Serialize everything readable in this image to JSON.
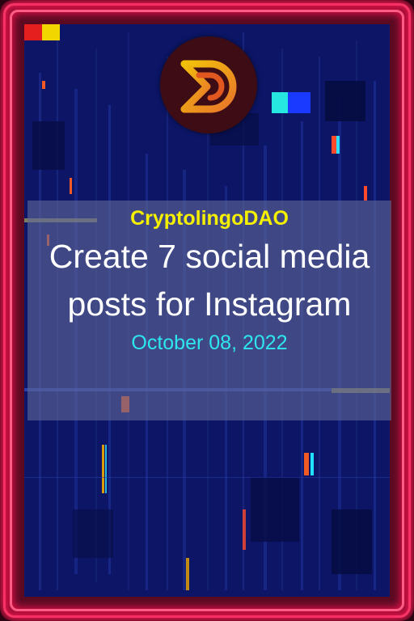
{
  "card": {
    "organization": "CryptolingoDAO",
    "title": "Create 7 social media posts for Instagram",
    "date": "October 08, 2022"
  },
  "logo": {
    "icon": "cryptolingo-d-logo-icon"
  },
  "colors": {
    "frame_glow": "#ff2a60",
    "background": "#0b1463",
    "organization_text": "#f5f000",
    "title_text": "#ffffff",
    "date_text": "#2ee6f0",
    "logo_circle": "#3d0c14"
  }
}
